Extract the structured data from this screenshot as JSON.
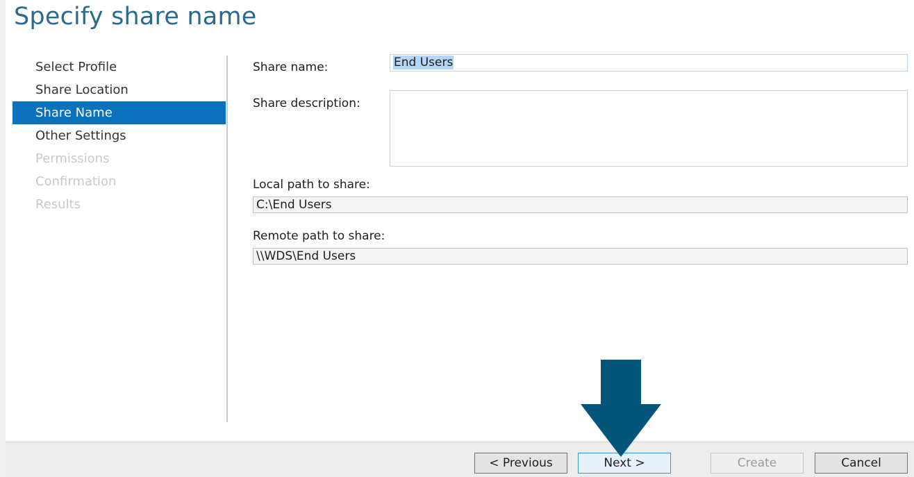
{
  "page": {
    "title": "Specify share name"
  },
  "nav": {
    "items": [
      {
        "label": "Select Profile",
        "state": "normal"
      },
      {
        "label": "Share Location",
        "state": "normal"
      },
      {
        "label": "Share Name",
        "state": "selected"
      },
      {
        "label": "Other Settings",
        "state": "normal"
      },
      {
        "label": "Permissions",
        "state": "disabled"
      },
      {
        "label": "Confirmation",
        "state": "disabled"
      },
      {
        "label": "Results",
        "state": "disabled"
      }
    ]
  },
  "form": {
    "share_name_label": "Share name:",
    "share_name_value": "End Users",
    "share_description_label": "Share description:",
    "share_description_value": "",
    "local_path_label": "Local path to share:",
    "local_path_value": "C:\\End Users",
    "remote_path_label": "Remote path to share:",
    "remote_path_value": "\\\\WDS\\End Users"
  },
  "footer": {
    "previous_label": "< Previous",
    "next_label": "Next >",
    "create_label": "Create",
    "cancel_label": "Cancel"
  },
  "colors": {
    "title": "#2b6a8c",
    "nav_selected_bg": "#0a72bd",
    "arrow": "#03567a"
  },
  "icons": {
    "annotation_arrow": "down-arrow-icon"
  }
}
